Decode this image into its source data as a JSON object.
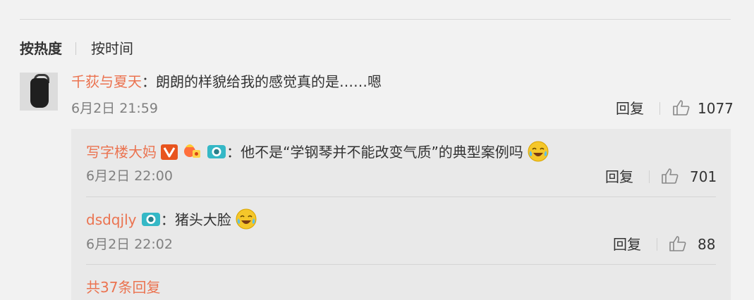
{
  "sort": {
    "hot": "按热度",
    "time": "按时间"
  },
  "comment": {
    "user": "千荻与夏天",
    "text": "：朗朗的样貌给我的感觉真的是……嗯",
    "time": "6月2日 21:59",
    "reply_label": "回复",
    "likes": "1077"
  },
  "replies": [
    {
      "user": "写字楼大妈",
      "text": "：他不是“学钢琴并不能改变气质”的典型案例吗",
      "time": "6月2日 22:00",
      "reply_label": "回复",
      "likes": "701"
    },
    {
      "user": "dsdqjly",
      "text": "：猪头大脸",
      "time": "6月2日 22:02",
      "reply_label": "回复",
      "likes": "88"
    }
  ],
  "more_replies": "共37条回复",
  "colors": {
    "username": "#eb7350",
    "vip_badge": "#e8541e",
    "camera_badge": "#35b8c6",
    "emoji": "#f5c72a"
  }
}
